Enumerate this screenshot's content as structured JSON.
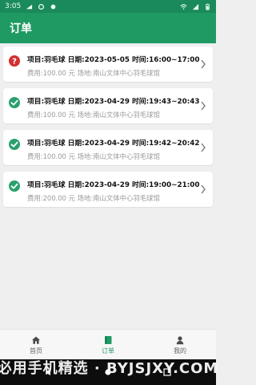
{
  "status_bar": {
    "time": "3:05"
  },
  "app_bar": {
    "title": "订单"
  },
  "orders": [
    {
      "status": "unknown",
      "line1": "项目:羽毛球  日期:2023-05-05 时间:16:00~17:00",
      "line2": "费用:100.00 元  场地:南山文体中心羽毛球馆"
    },
    {
      "status": "done",
      "line1": "项目:羽毛球  日期:2023-04-29 时间:19:43~20:43",
      "line2": "费用:100.00 元  场地:南山文体中心羽毛球馆"
    },
    {
      "status": "done",
      "line1": "项目:羽毛球  日期:2023-04-29 时间:19:42~20:42",
      "line2": "费用:100.00 元  场地:南山文体中心羽毛球馆"
    },
    {
      "status": "done",
      "line1": "项目:羽毛球  日期:2023-04-29 时间:19:00~21:00",
      "line2": "费用:200.00 元  场地:南山文体中心羽毛球馆"
    }
  ],
  "bottom_nav": {
    "items": [
      {
        "label": "首页",
        "icon": "home-icon",
        "active": false
      },
      {
        "label": "订单",
        "icon": "order-icon",
        "active": true
      },
      {
        "label": "我的",
        "icon": "profile-icon",
        "active": false
      }
    ]
  },
  "watermark": {
    "text": "必用手机精选 · BYJSJXY.COM"
  },
  "colors": {
    "primary": "#1f9a63",
    "status_unknown": "#d32f2f",
    "status_done": "#2aa06d"
  }
}
